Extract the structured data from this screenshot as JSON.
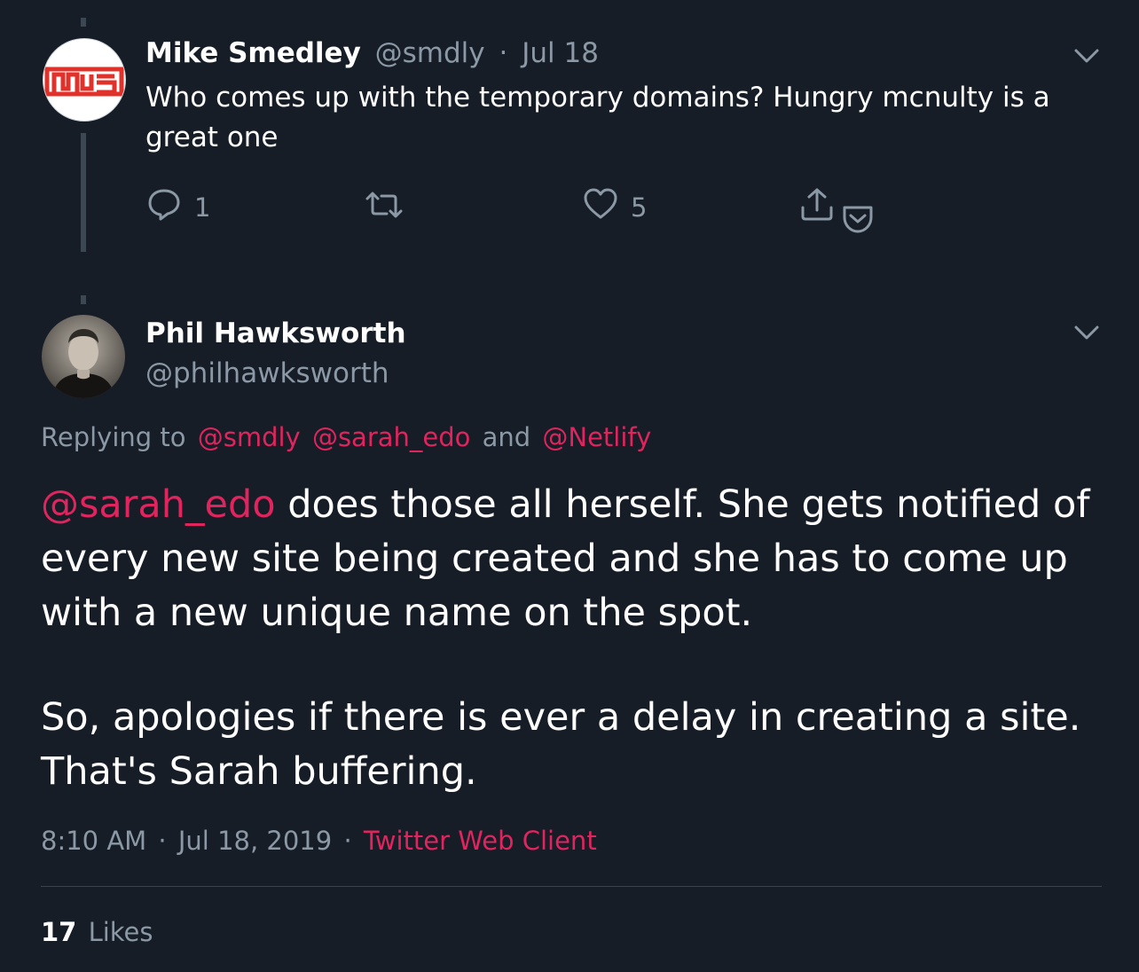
{
  "parent_tweet": {
    "author_name": "Mike Smedley",
    "handle": "@smdly",
    "separator": "·",
    "date": "Jul 18",
    "text": "Who comes up with the temporary domains? Hungry mcnulty is a great one",
    "reply_count": "1",
    "retweet_count": "",
    "like_count": "5"
  },
  "main_tweet": {
    "author_name": "Phil Hawksworth",
    "handle": "@philhawksworth",
    "replying_to_label": "Replying to",
    "reply_mentions": [
      "@smdly",
      "@sarah_edo",
      "@Netlify"
    ],
    "reply_and": "and",
    "body_mention": "@sarah_edo",
    "body_line1": " does those all herself. She gets notified of every new site being created and she has to come up with a new unique name on the spot.",
    "body_para2": "So, apologies if there is ever a delay in creating a site. That's Sarah buffering.",
    "time": "8:10 AM",
    "date": "Jul 18, 2019",
    "separator": "·",
    "client": "Twitter Web Client",
    "likes_count": "17",
    "likes_label": "Likes"
  },
  "colors": {
    "background": "#161d27",
    "accent": "#e0245e",
    "muted": "#8b98a5",
    "logo_red": "#e0312a"
  },
  "icons": [
    "chevron-down-icon",
    "reply-icon",
    "retweet-icon",
    "like-icon",
    "share-icon",
    "pocket-icon"
  ]
}
